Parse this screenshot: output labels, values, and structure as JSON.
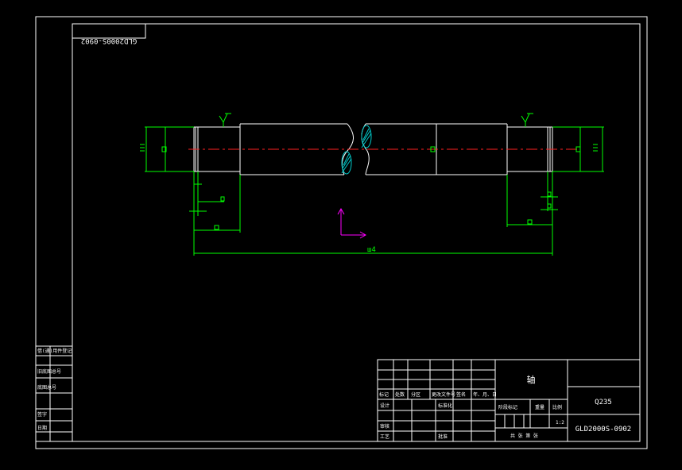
{
  "drawing": {
    "mirrored_code": "GLD2000S-0902",
    "part_name": "轴",
    "material": "Q235",
    "drawing_number": "GLD2000S-0902",
    "scale": "1:2",
    "overall_length_dim": "ш4",
    "sheet_note": "共 张 第 张"
  },
  "title_block": {
    "header_labels": [
      "标记",
      "处数",
      "分区",
      "更改文件号",
      "签名",
      "年、月、日"
    ],
    "row_labels": [
      "设计",
      "审核",
      "工艺"
    ],
    "std_label": "标准化",
    "approve_label": "批准",
    "stage_label": "阶段标记",
    "weight_label": "重量",
    "scale_label": "比例"
  },
  "side_block": {
    "labels": [
      "借(通)用件登记",
      "旧底图总号",
      "底图总号",
      "签字",
      "日期"
    ]
  },
  "colors": {
    "outline": "#ffffff",
    "dimension": "#00ff00",
    "centerline": "#ff2020",
    "hatch": "#00c8c8",
    "ucs": "#ff00ff"
  }
}
